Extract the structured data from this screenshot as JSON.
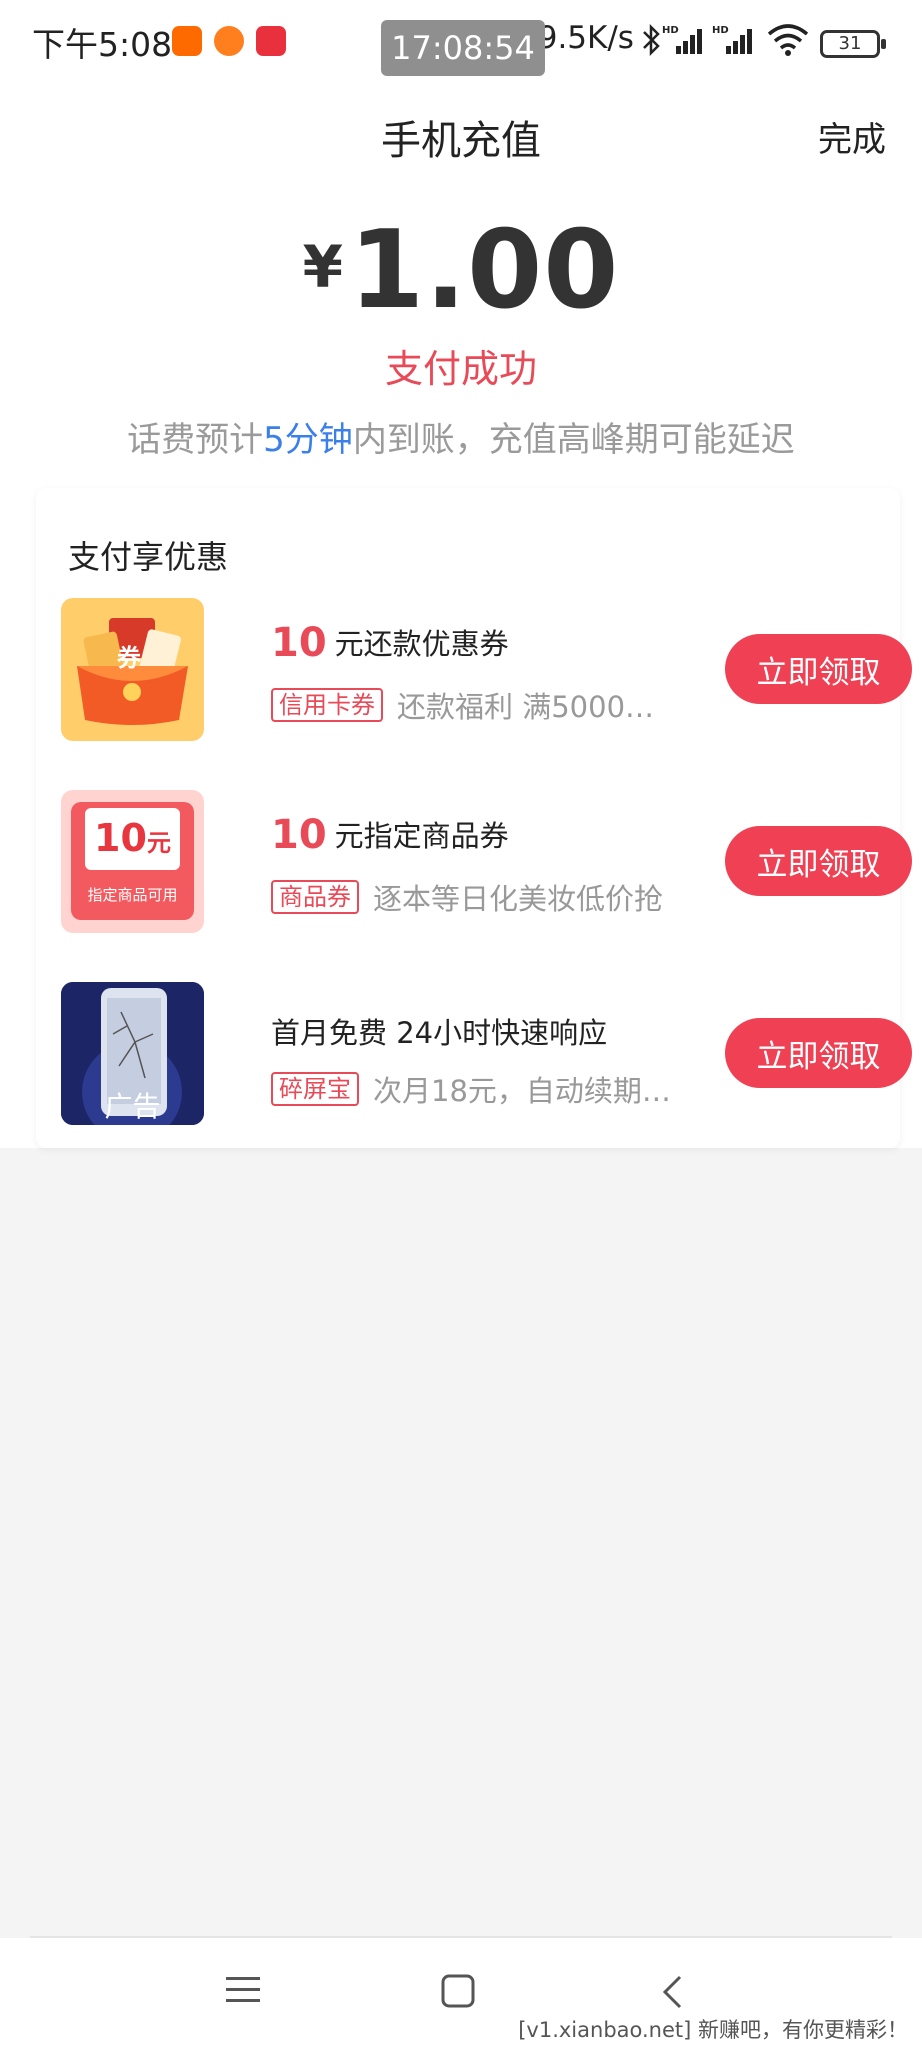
{
  "status_bar": {
    "time": "下午5:08",
    "clock_overlay": "17:08:54",
    "net_speed": "19.5K/s",
    "battery": "31",
    "icons": [
      "mi-app-icon",
      "tiger-app-icon",
      "red-app-icon",
      "bluetooth-icon",
      "signal-hd-icon",
      "signal-hd-icon",
      "wifi-icon",
      "battery-icon"
    ]
  },
  "header": {
    "title": "手机充值",
    "done_label": "完成"
  },
  "payment": {
    "currency_symbol": "¥",
    "amount": "1.00",
    "status": "支付成功",
    "note_prefix": "话费预计",
    "note_highlight": "5分钟",
    "note_suffix": "内到账，充值高峰期可能延迟"
  },
  "promo": {
    "title": "支付享优惠",
    "items": [
      {
        "amount": "10",
        "title": "元还款优惠券",
        "tag": "信用卡券",
        "desc": "还款福利 满5000…",
        "button": "立即领取",
        "image_text": "券"
      },
      {
        "amount": "10",
        "title": "元指定商品券",
        "tag": "商品券",
        "desc": "逐本等日化美妆低价抢",
        "button": "立即领取",
        "image_value": "10",
        "image_unit": "元",
        "image_caption": "指定商品可用"
      },
      {
        "title": "首月免费 24小时快速响应",
        "tag": "碎屏宝",
        "desc": "次月18元，自动续期…",
        "button": "立即领取",
        "image_caption": "广告"
      }
    ]
  },
  "watermark": "[v1.xianbao.net] 新赚吧，有你更精彩！",
  "colors": {
    "accent_red": "#ef4153",
    "highlight_blue": "#3b7fe9",
    "text_gray": "#9a9a9a"
  }
}
